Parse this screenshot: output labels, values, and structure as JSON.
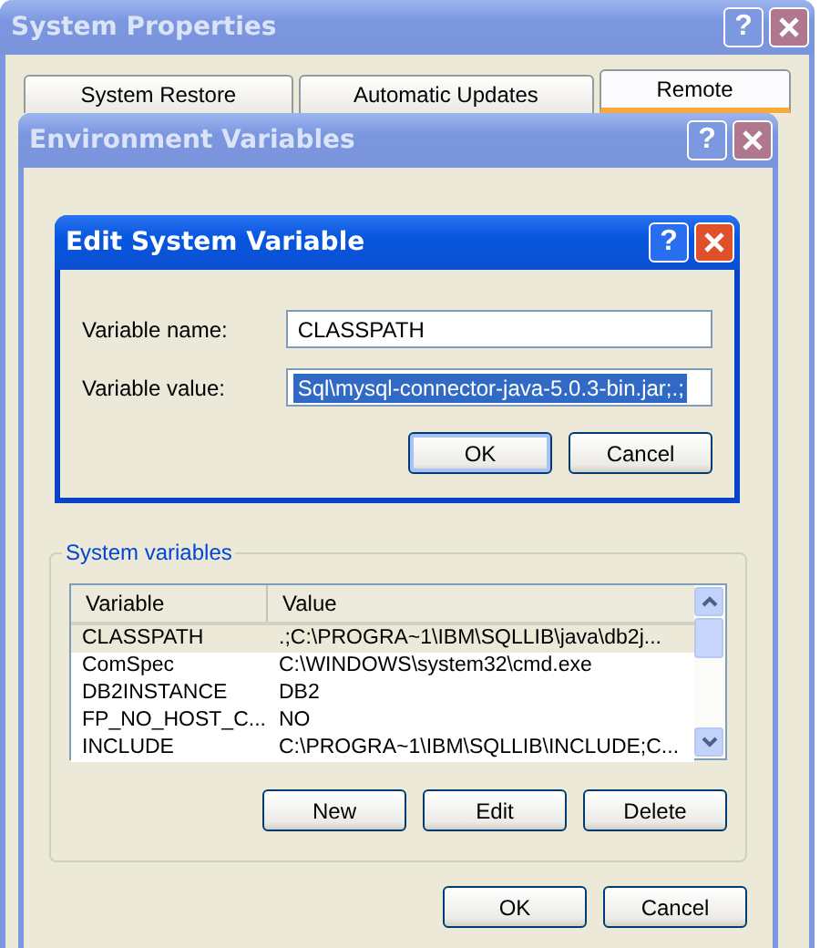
{
  "system_properties": {
    "title": "System Properties",
    "active": false,
    "help": "?",
    "tabs": [
      {
        "label": "System Restore",
        "selected": false
      },
      {
        "label": "Automatic Updates",
        "selected": false
      },
      {
        "label": "Remote",
        "selected": true
      }
    ]
  },
  "environment_variables": {
    "title": "Environment Variables",
    "active": false,
    "help": "?",
    "system_variables": {
      "label": "System variables",
      "columns": [
        "Variable",
        "Value"
      ],
      "rows": [
        {
          "variable": "CLASSPATH",
          "value": ".;C:\\PROGRA~1\\IBM\\SQLLIB\\java\\db2j...",
          "selected": true
        },
        {
          "variable": "ComSpec",
          "value": "C:\\WINDOWS\\system32\\cmd.exe",
          "selected": false
        },
        {
          "variable": "DB2INSTANCE",
          "value": "DB2",
          "selected": false
        },
        {
          "variable": "FP_NO_HOST_C...",
          "value": "NO",
          "selected": false
        },
        {
          "variable": "INCLUDE",
          "value": "C:\\PROGRA~1\\IBM\\SQLLIB\\INCLUDE;C...",
          "selected": false
        }
      ],
      "buttons": [
        "New",
        "Edit",
        "Delete"
      ]
    },
    "buttons": [
      "OK",
      "Cancel"
    ]
  },
  "edit_dialog": {
    "title": "Edit System Variable",
    "active": true,
    "help": "?",
    "fields": [
      {
        "label": "Variable name:",
        "value": "CLASSPATH",
        "selected": false
      },
      {
        "label": "Variable value:",
        "value": "Sql\\mysql-connector-java-5.0.3-bin.jar;.;",
        "selected": true
      }
    ],
    "buttons": [
      "OK",
      "Cancel"
    ]
  }
}
